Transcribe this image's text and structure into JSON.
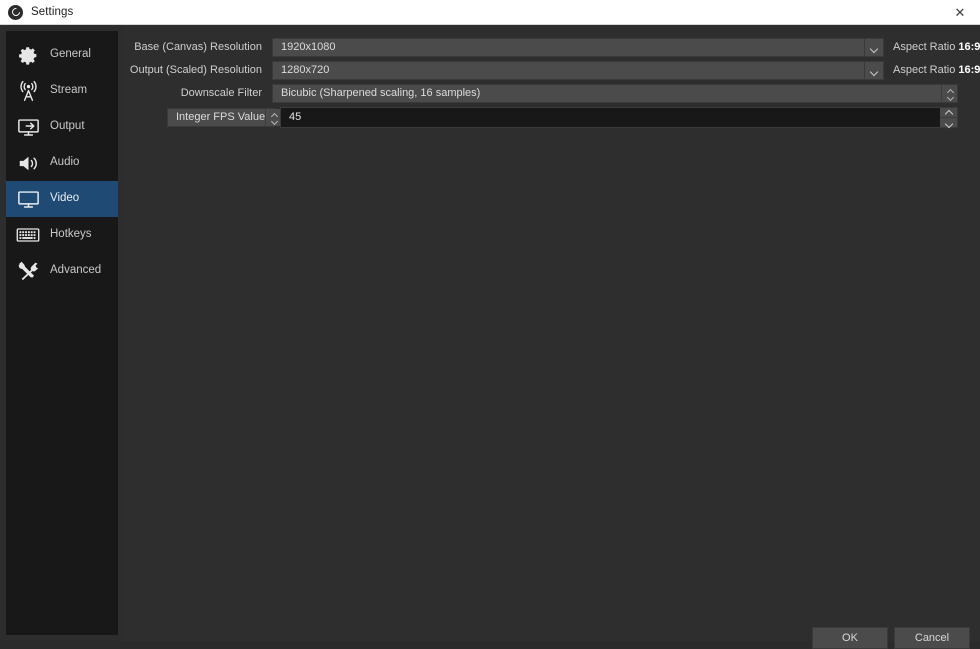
{
  "titlebar": {
    "title": "Settings",
    "logo_icon": "obs-logo-icon",
    "close_label": "✕"
  },
  "sidebar": {
    "items": [
      {
        "label": "General",
        "icon": "gear-icon",
        "selected": false
      },
      {
        "label": "Stream",
        "icon": "broadcast-icon",
        "selected": false
      },
      {
        "label": "Output",
        "icon": "output-monitor-icon",
        "selected": false
      },
      {
        "label": "Audio",
        "icon": "speaker-icon",
        "selected": false
      },
      {
        "label": "Video",
        "icon": "monitor-icon",
        "selected": true
      },
      {
        "label": "Hotkeys",
        "icon": "keyboard-icon",
        "selected": false
      },
      {
        "label": "Advanced",
        "icon": "tools-icon",
        "selected": false
      }
    ],
    "selected_index": 4,
    "selection_color": "#1f4a73",
    "background_color": "#181818"
  },
  "video_settings": {
    "base_resolution": {
      "label": "Base (Canvas) Resolution",
      "value": "1920x1080",
      "aspect_label": "Aspect Ratio",
      "aspect_value": "16:9"
    },
    "output_resolution": {
      "label": "Output (Scaled) Resolution",
      "value": "1280x720",
      "aspect_label": "Aspect Ratio",
      "aspect_value": "16:9"
    },
    "downscale_filter": {
      "label": "Downscale Filter",
      "value": "Bicubic (Sharpened scaling, 16 samples)"
    },
    "fps": {
      "mode_label": "Integer FPS Value",
      "value": "45"
    }
  },
  "footer": {
    "ok_label": "OK",
    "cancel_label": "Cancel"
  },
  "theme": {
    "panel_background": "#2e2e2e",
    "input_background": "#4b4b4b",
    "spin_input_background": "#181818",
    "text_color": "#cfcfcf",
    "accent": "#1f4a73"
  }
}
